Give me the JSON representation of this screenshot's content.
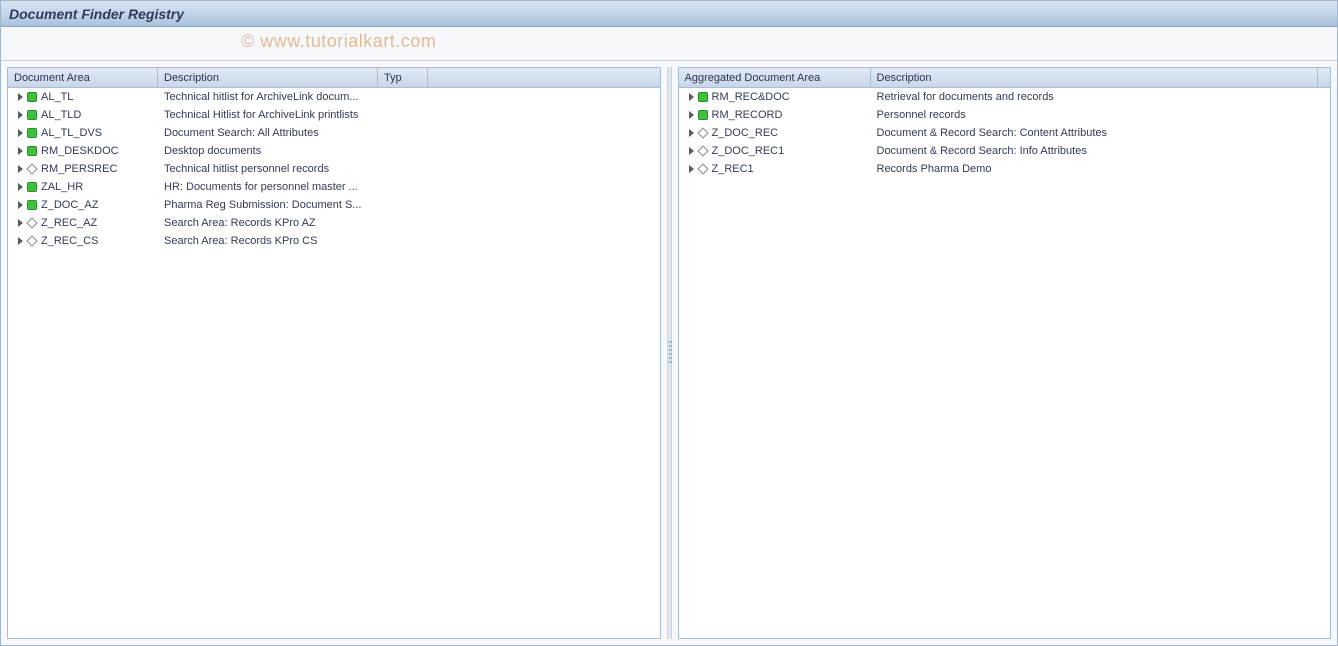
{
  "title": "Document Finder Registry",
  "watermark": "© www.tutorialkart.com",
  "left_panel": {
    "columns": {
      "area": "Document Area",
      "desc": "Description",
      "typ": "Typ"
    },
    "rows": [
      {
        "area": "AL_TL",
        "desc": "Technical hitlist for ArchiveLink docum...",
        "icon": "green"
      },
      {
        "area": "AL_TLD",
        "desc": "Technical Hitlist for ArchiveLink printlists",
        "icon": "green"
      },
      {
        "area": "AL_TL_DVS",
        "desc": "Document Search: All Attributes",
        "icon": "green"
      },
      {
        "area": "RM_DESKDOC",
        "desc": "Desktop documents",
        "icon": "green"
      },
      {
        "area": "RM_PERSREC",
        "desc": "Technical hitlist personnel records",
        "icon": "diamond"
      },
      {
        "area": "ZAL_HR",
        "desc": "HR: Documents for personnel master ...",
        "icon": "green"
      },
      {
        "area": "Z_DOC_AZ",
        "desc": "Pharma Reg Submission: Document S...",
        "icon": "green"
      },
      {
        "area": "Z_REC_AZ",
        "desc": "Search Area: Records KPro AZ",
        "icon": "diamond"
      },
      {
        "area": "Z_REC_CS",
        "desc": "Search Area: Records KPro CS",
        "icon": "diamond"
      }
    ]
  },
  "right_panel": {
    "columns": {
      "area": "Aggregated Document Area",
      "desc": "Description"
    },
    "rows": [
      {
        "area": "RM_REC&DOC",
        "desc": "Retrieval for documents and records",
        "icon": "green"
      },
      {
        "area": "RM_RECORD",
        "desc": "Personnel records",
        "icon": "green"
      },
      {
        "area": "Z_DOC_REC",
        "desc": "Document & Record Search: Content Attributes",
        "icon": "diamond"
      },
      {
        "area": "Z_DOC_REC1",
        "desc": "Document & Record Search: Info Attributes",
        "icon": "diamond"
      },
      {
        "area": "Z_REC1",
        "desc": "Records Pharma Demo",
        "icon": "diamond"
      }
    ]
  }
}
